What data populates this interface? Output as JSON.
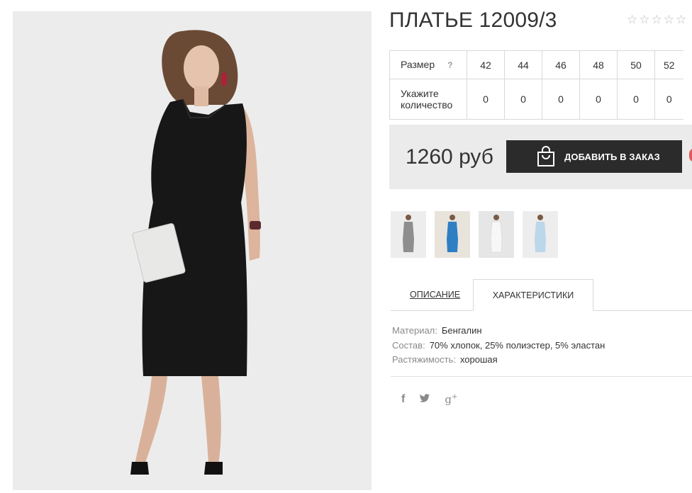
{
  "product": {
    "title": "ПЛАТЬЕ 12009/3",
    "rating": 0,
    "rating_max": 5
  },
  "size_table": {
    "size_label": "Размер",
    "help": "?",
    "sizes": [
      "42",
      "44",
      "46",
      "48",
      "50",
      "52"
    ],
    "qty_label": "Укажите количество",
    "quantities": [
      "0",
      "0",
      "0",
      "0",
      "0",
      "0"
    ]
  },
  "purchase": {
    "price": "1260 руб",
    "add_button_label": "ДОБАВИТЬ В ЗАКАЗ",
    "icons": {
      "bag": "shopping-bag-icon"
    }
  },
  "thumbnails": [
    {
      "name": "gray",
      "color": "#8e8e8e"
    },
    {
      "name": "blue",
      "color": "#2f7fc4"
    },
    {
      "name": "white",
      "color": "#f4f4f4"
    },
    {
      "name": "light-blue",
      "color": "#bcd6ea"
    }
  ],
  "tabs": {
    "description": "ОПИСАНИЕ",
    "characteristics": "ХАРАКТЕРИСТИКИ",
    "active": "characteristics"
  },
  "characteristics": [
    {
      "key": "Материал:",
      "value": "Бенгалин"
    },
    {
      "key": "Состав:",
      "value": "70% хлопок, 25% полиэстер, 5% эластан"
    },
    {
      "key": "Растяжимость:",
      "value": "хорошая"
    }
  ],
  "social": {
    "facebook": "f",
    "twitter": "twitter-icon",
    "google_plus": "g"
  },
  "colors": {
    "button_bg": "#2b2b2b",
    "panel_bg": "#ebebeb",
    "dress": "#171717"
  }
}
